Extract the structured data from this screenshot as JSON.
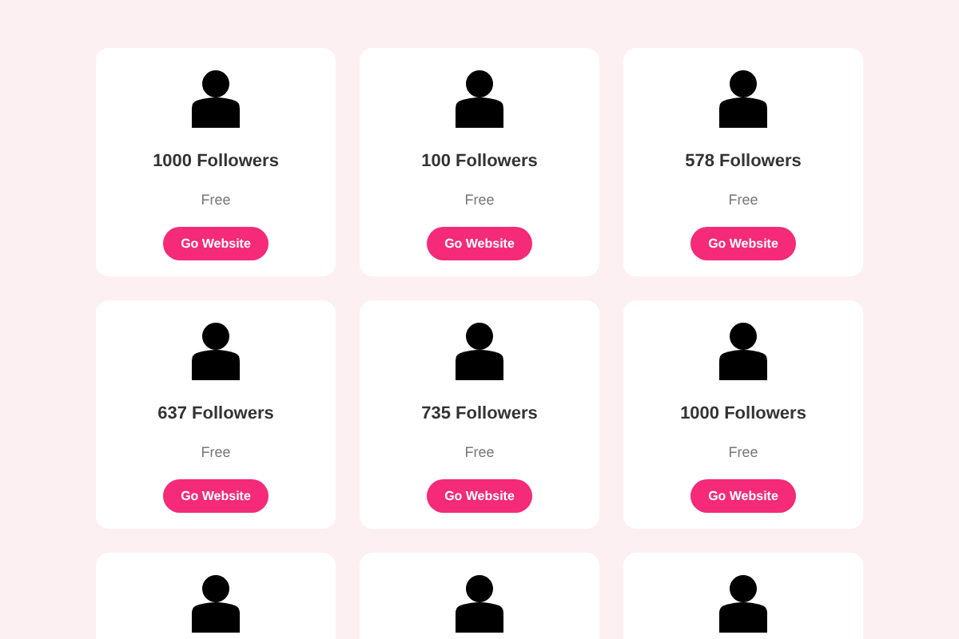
{
  "cards": [
    {
      "avatar": true,
      "followers": "1000 Followers",
      "price": "Free",
      "button": "Go Website"
    },
    {
      "avatar": true,
      "followers": "100 Followers",
      "price": "Free",
      "button": "Go Website"
    },
    {
      "avatar": true,
      "followers": "578 Followers",
      "price": "Free",
      "button": "Go Website"
    },
    {
      "avatar": true,
      "followers": "637 Followers",
      "price": "Free",
      "button": "Go Website"
    },
    {
      "avatar": true,
      "followers": "735 Followers",
      "price": "Free",
      "button": "Go Website"
    },
    {
      "avatar": true,
      "followers": "1000 Followers",
      "price": "Free",
      "button": "Go Website"
    },
    {
      "avatar": true
    },
    {
      "avatar": true
    },
    {
      "avatar": true
    }
  ]
}
